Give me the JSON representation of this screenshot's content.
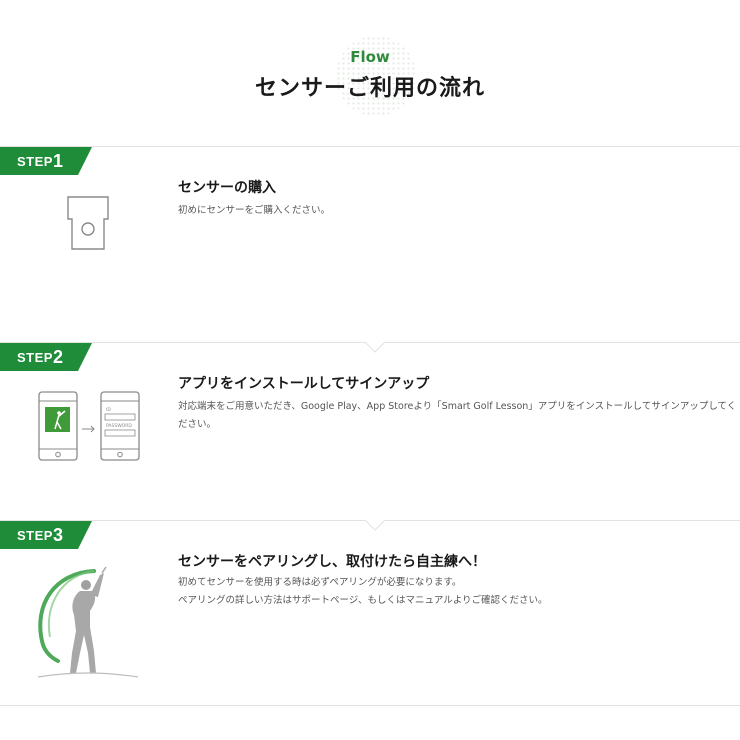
{
  "header": {
    "eyebrow": "Flow",
    "title": "センサーご利用の流れ"
  },
  "colors": {
    "accent": "#2f8a3c",
    "badge": "#1f8c3a",
    "text": "#1a1a1a",
    "muted": "#555555",
    "border": "#e2e2e2"
  },
  "steps": [
    {
      "badge_label": "STEP",
      "badge_number": "1",
      "heading": "センサーの購入",
      "description": "初めにセンサーをご購入ください。",
      "icon": "sensor-device-icon"
    },
    {
      "badge_label": "STEP",
      "badge_number": "2",
      "heading": "アプリをインストールしてサインアップ",
      "description": "対応端末をご用意いただき、Google Play、App Storeより「Smart Golf Lesson」アプリをインストールしてサインアップしてください。",
      "icon": "phone-app-signup-icon",
      "phone_fields": [
        "ID",
        "PASSWORD"
      ]
    },
    {
      "badge_label": "STEP",
      "badge_number": "3",
      "heading": "センサーをペアリングし、取付けたら自主練へ！",
      "description_lines": [
        "初めてセンサーを使用する時は必ずペアリングが必要になります。",
        "ペアリングの詳しい方法はサポートページ、もしくはマニュアルよりご確認ください。"
      ],
      "icon": "golfer-swing-icon"
    }
  ]
}
